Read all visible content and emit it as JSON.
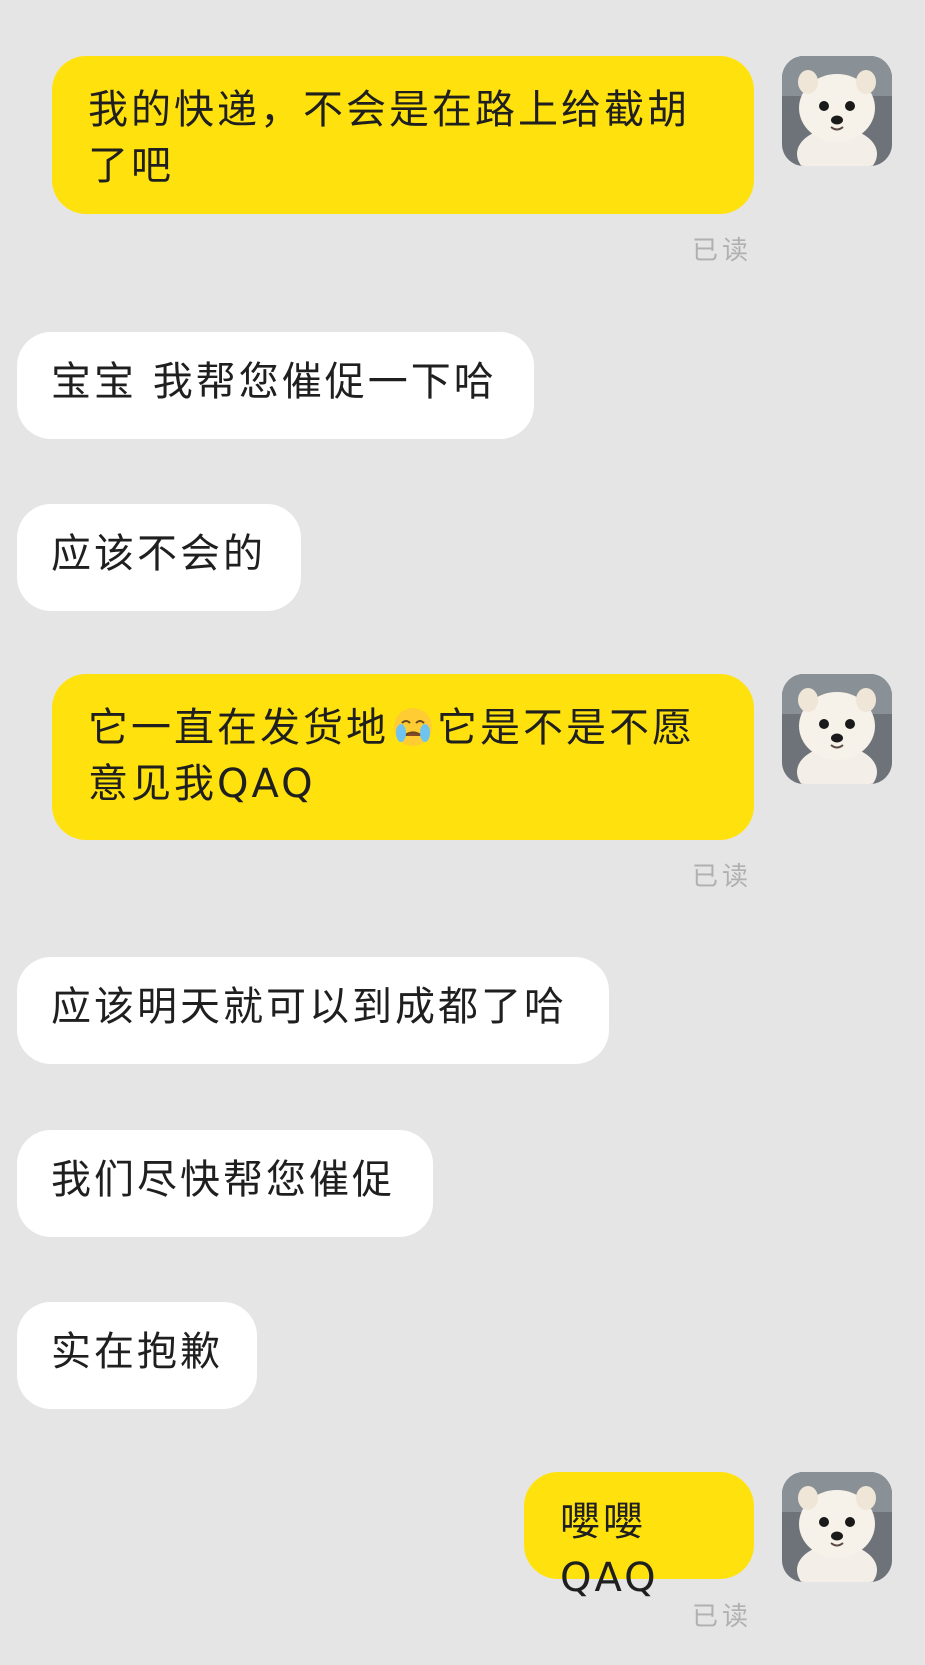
{
  "messages": [
    {
      "side": "mine",
      "text": "我的快递，不会是在路上给截胡了吧",
      "read": "已读"
    },
    {
      "side": "theirs",
      "text": "宝宝 我帮您催促一下哈"
    },
    {
      "side": "theirs",
      "text": "应该不会的"
    },
    {
      "side": "mine",
      "text_before": "它一直在发货地",
      "emoji": "crying-face",
      "text_after": "它是不是不愿意见我QAQ",
      "read": "已读"
    },
    {
      "side": "theirs",
      "text": "应该明天就可以到成都了哈"
    },
    {
      "side": "theirs",
      "text": "我们尽快帮您催促"
    },
    {
      "side": "theirs",
      "text": "实在抱歉"
    },
    {
      "side": "mine",
      "text": "嚶嚶QAQ",
      "read": "已读"
    }
  ],
  "avatar": {
    "icon": "pomeranian-dog-avatar"
  },
  "colors": {
    "background": "#e5e5e5",
    "mine_bubble": "#ffe20d",
    "theirs_bubble": "#ffffff",
    "read_text": "#b0b0b0"
  }
}
